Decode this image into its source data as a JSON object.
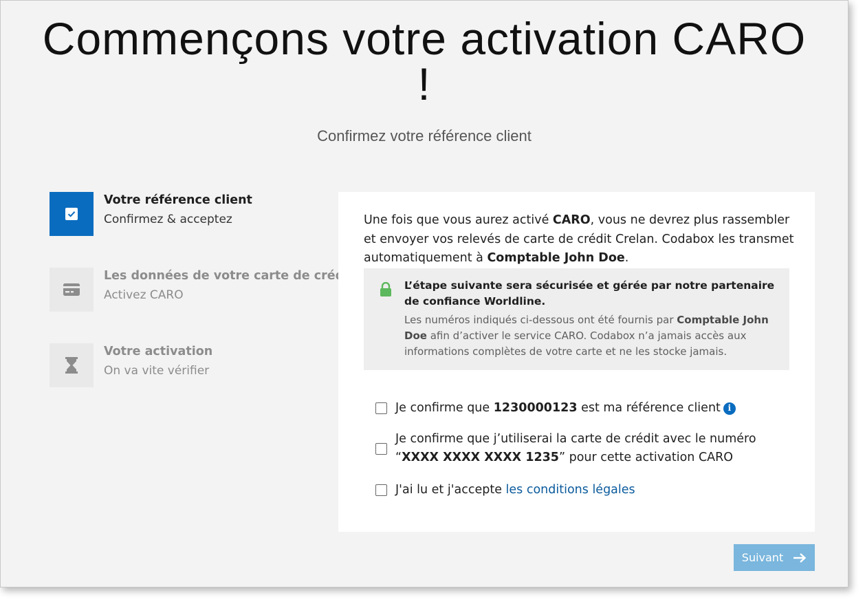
{
  "header": {
    "title": "Commençons votre activation CARO !",
    "subtitle": "Confirmez votre référence client"
  },
  "steps": [
    {
      "title": "Votre référence client",
      "description": "Confirmez & acceptez",
      "state": "active",
      "icon": "checkbox-icon"
    },
    {
      "title": "Les données de votre carte de crédit",
      "description": "Activez CARO",
      "state": "inactive",
      "icon": "credit-card-icon"
    },
    {
      "title": "Votre activation",
      "description": "On va vite vérifier",
      "state": "inactive",
      "icon": "hourglass-icon"
    }
  ],
  "intro": {
    "part1": "Une fois que vous aurez activé ",
    "caro": "CARO",
    "part2": ", vous ne devrez plus rassembler et envoyer vos relevés de carte de crédit Crelan. Codabox les transmet automatiquement à ",
    "accountant": "Comptable John Doe",
    "part3": "."
  },
  "secure_notice": {
    "icon": "lock-icon",
    "title": "L’étape suivante sera sécurisée et gérée par notre partenaire de confiance Worldline.",
    "text_part1": "Les numéros indiqués ci-dessous ont été fournis par ",
    "accountant": "Comptable John Doe",
    "text_part2": " afin d’activer le service CARO. Codabox n’a jamais accès aux informations complètes de votre carte et ne les stocke jamais."
  },
  "confirmations": {
    "reference": {
      "prefix": "Je confirme que ",
      "value": "1230000123",
      "suffix": " est ma référence client",
      "checked": false,
      "info_icon": "info-icon"
    },
    "card": {
      "prefix": "Je confirme que j’utiliserai la carte de crédit avec le numéro “",
      "value": "XXXX XXXX XXXX 1235",
      "suffix": "” pour cette activation CARO",
      "checked": false
    },
    "legal": {
      "prefix": "J'ai lu et j'accepte ",
      "link_label": "les conditions légales",
      "checked": false
    }
  },
  "next_button": {
    "label": "Suivant",
    "icon": "arrow-right-icon"
  },
  "colors": {
    "primary": "#0a6cbf",
    "button_disabled": "#7ab6dd",
    "lock_green": "#5cb85c",
    "background": "#f3f3f3"
  }
}
